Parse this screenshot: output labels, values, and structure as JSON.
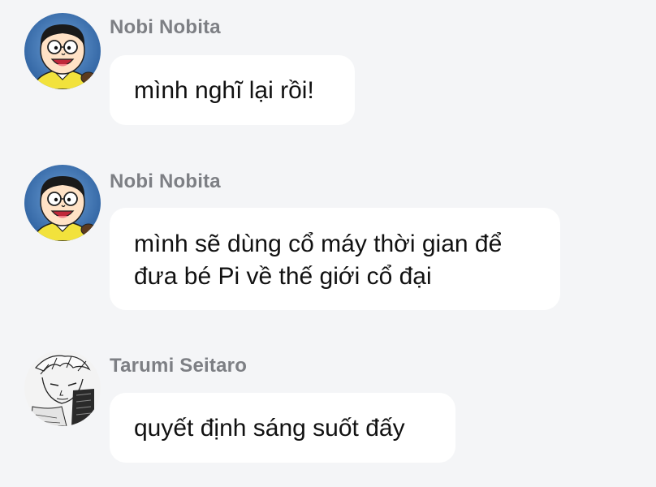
{
  "messages": [
    {
      "sender": "Nobi Nobita",
      "avatar_icon": "nobita-avatar-icon",
      "lines": [
        "mình nghĩ lại rồi!"
      ]
    },
    {
      "sender": "Nobi Nobita",
      "avatar_icon": "nobita-avatar-icon",
      "lines": [
        "mình sẽ dùng cổ máy thời gian để",
        "đưa bé Pi về thế giới cổ đại"
      ]
    },
    {
      "sender": "Tarumi Seitaro",
      "avatar_icon": "tarumi-avatar-icon",
      "lines": [
        "quyết định sáng suốt đấy"
      ]
    }
  ],
  "colors": {
    "background": "#f4f5f7",
    "bubble": "#ffffff",
    "sender_name": "#7d7f84",
    "message_text": "#111111"
  }
}
